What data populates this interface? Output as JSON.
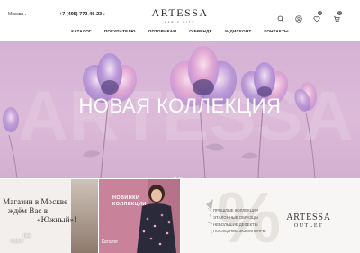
{
  "header": {
    "city": "Москва",
    "phone": "+7 (495) 772-46-23",
    "logo": "ARTESSA",
    "logo_sub": "PARIS CITY",
    "icons": [
      "search-icon",
      "user-icon",
      "heart-icon",
      "cart-icon"
    ],
    "wishlist_count": "0",
    "cart_count": "0"
  },
  "nav": {
    "items": [
      "КАТАЛОГ",
      "ПОКУПАТЕЛЮ",
      "ОПТОВИКАМ",
      "О БРЕНДЕ",
      "% ДИСКОНТ",
      "КОНТАКТЫ"
    ]
  },
  "hero": {
    "title": "НОВАЯ КОЛЛЕКЦИЯ",
    "slides": 2,
    "active_slide": 1
  },
  "tiles": {
    "shop": {
      "line1": "Магазин в Москве",
      "line2": "ждём Вас в",
      "line3": "«Южный»!",
      "caption_line1": "ние",
      "caption_line2": "изине"
    },
    "catalog": {
      "title_line1": "НОВИНКИ",
      "title_line2": "КОЛЛЕКЦИИ",
      "caption": "Каталог"
    },
    "outlet": {
      "list": [
        "ПРОШЛЫЕ КОЛЛЕКЦИИ",
        "ЭТАЛОННЫЕ ОБРАЗЦЫ",
        "НЕБОЛЬШИЕ ДЕФЕКТЫ",
        "ПОСЛЕДНИЕ ЭКЗЕМПЛЯРЫ"
      ],
      "logo": "ARTESSA",
      "logo_sub": "OUTLET"
    }
  },
  "colors": {
    "hero_bg": "#d8b4d6",
    "catalog_tile": "#c8829a",
    "badge": "#555555"
  }
}
